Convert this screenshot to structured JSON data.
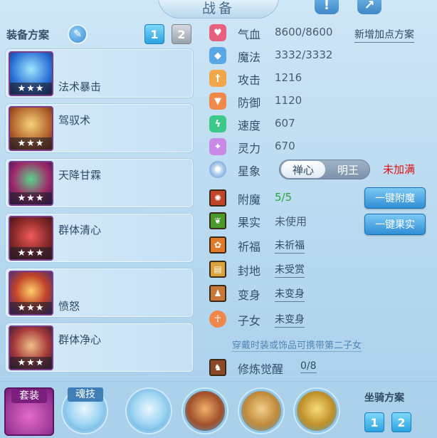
{
  "header": {
    "title": "战备"
  },
  "plan": {
    "title": "装备方案",
    "pages": [
      "1",
      "2"
    ]
  },
  "skills": [
    {
      "name": "法术暴击",
      "stars": "★★★"
    },
    {
      "name": "驾驭术",
      "stars": "★★★"
    },
    {
      "name": "天降甘霖",
      "stars": "★★★"
    },
    {
      "name": "群体清心",
      "stars": "★★★"
    },
    {
      "name": "愤怒",
      "stars": "★★★"
    },
    {
      "name": "群体净心",
      "stars": "★★★"
    }
  ],
  "stats": [
    {
      "name": "气血",
      "value": "8600/8600",
      "icon": "heart-icon",
      "color": "#e8607f"
    },
    {
      "name": "魔法",
      "value": "3332/3332",
      "icon": "mana-icon",
      "color": "#5aa7e6"
    },
    {
      "name": "攻击",
      "value": "1216",
      "icon": "attack-icon",
      "color": "#f2a64a"
    },
    {
      "name": "防御",
      "value": "1120",
      "icon": "defense-icon",
      "color": "#f08a4a"
    },
    {
      "name": "速度",
      "value": "607",
      "icon": "speed-icon",
      "color": "#3cc98a"
    },
    {
      "name": "灵力",
      "value": "670",
      "icon": "spirit-icon",
      "color": "#c88ae6"
    }
  ],
  "add_plan_link": "新增加点方案",
  "constellation": {
    "label": "星象",
    "option_on": "禅心",
    "option_off": "明王",
    "status": "未加满"
  },
  "enchant": {
    "label": "附魔",
    "value": "5/5",
    "button": "一键附魔"
  },
  "fruit": {
    "label": "果实",
    "value": "未使用",
    "button": "一键果实"
  },
  "blessing": {
    "label": "祈福",
    "value": "未祈福"
  },
  "fief": {
    "label": "封地",
    "value": "未受赏"
  },
  "transform": {
    "label": "变身",
    "value": "未变身"
  },
  "children": {
    "label": "子女",
    "value": "未变身"
  },
  "hint": "穿戴时装或饰品可携带第二子女",
  "cultivation": {
    "label": "修炼觉醒",
    "value": "0/8"
  },
  "bottom": {
    "suit_label": "套装",
    "soul_label": "魂技",
    "mount_title": "坐骑方案",
    "mount_pages": [
      "1",
      "2"
    ]
  }
}
